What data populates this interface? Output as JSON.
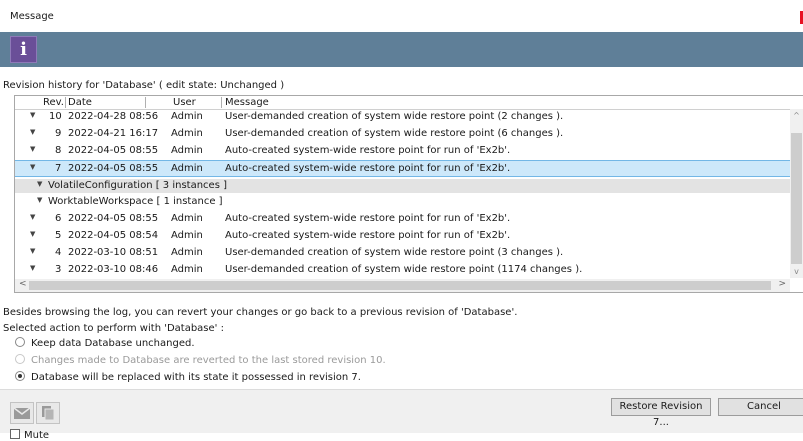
{
  "window": {
    "title": "Message"
  },
  "header": {
    "info_glyph": "i",
    "info_icon": "info-icon",
    "band_color": "#5f7f98",
    "tile_color": "#6a4f98"
  },
  "history": {
    "heading": "Revision history for 'Database'  ( edit state: Unchanged )",
    "columns": {
      "rev": "Rev.",
      "date": "Date",
      "user": "User",
      "message": "Message"
    },
    "rows": [
      {
        "rev": "10",
        "date": "2022-04-28 08:56",
        "user": "Admin",
        "message": "User-demanded creation of system wide restore point (2 changes )."
      },
      {
        "rev": "9",
        "date": "2022-04-21 16:17",
        "user": "Admin",
        "message": "User-demanded creation of system wide restore point (6 changes )."
      },
      {
        "rev": "8",
        "date": "2022-04-05 08:55",
        "user": "Admin",
        "message": "Auto-created system-wide restore point for run of 'Ex2b'."
      },
      {
        "rev": "7",
        "date": "2022-04-05 08:55",
        "user": "Admin",
        "message": "Auto-created system-wide restore point for run of 'Ex2b'."
      },
      {
        "rev": "6",
        "date": "2022-04-05 08:55",
        "user": "Admin",
        "message": "Auto-created system-wide restore point for run of 'Ex2b'."
      },
      {
        "rev": "5",
        "date": "2022-04-05 08:54",
        "user": "Admin",
        "message": "Auto-created system-wide restore point for run of 'Ex2b'."
      },
      {
        "rev": "4",
        "date": "2022-03-10 08:51",
        "user": "Admin",
        "message": "User-demanded creation of system wide restore point (3 changes )."
      },
      {
        "rev": "3",
        "date": "2022-03-10 08:46",
        "user": "Admin",
        "message": "User-demanded creation of system wide restore point (1174 changes )."
      }
    ],
    "groups": [
      {
        "label": "VolatileConfiguration  [ 3 instances ]"
      },
      {
        "label": "WorktableWorkspace  [ 1 instance ]"
      }
    ],
    "selected_rev": "7"
  },
  "actions": {
    "info_text": "Besides browsing the log, you can revert your changes or go back to a previous revision of 'Database'.",
    "label": "Selected action to perform with 'Database' :",
    "options": [
      {
        "text": "Keep data Database unchanged.",
        "selected": false,
        "enabled": true
      },
      {
        "text": "Changes made to Database are reverted to the last stored revision 10.",
        "selected": false,
        "enabled": false
      },
      {
        "text": "Database will be replaced with its state it possessed in revision 7.",
        "selected": true,
        "enabled": true
      }
    ]
  },
  "footer": {
    "restore_label": "Restore Revision 7...",
    "cancel_label": "Cancel",
    "mute_label": "Mute",
    "mail_icon": "mail-icon",
    "copy_icon": "copy-icon"
  }
}
